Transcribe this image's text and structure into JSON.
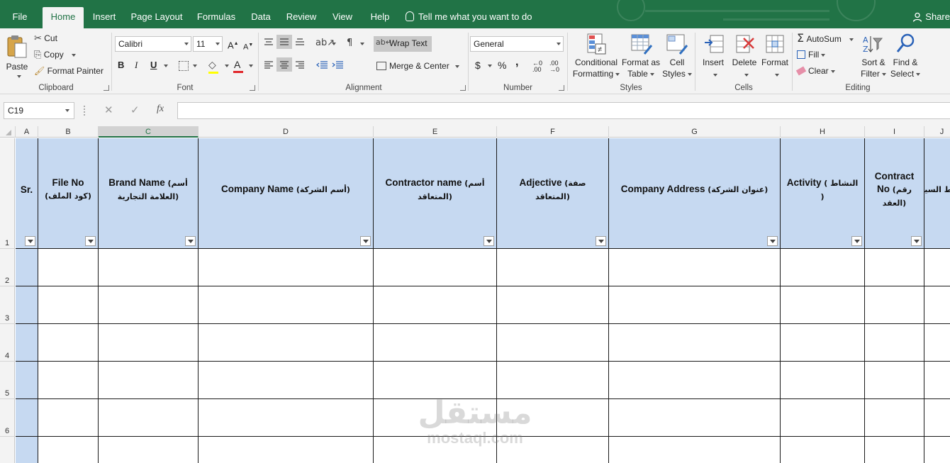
{
  "tabs": [
    {
      "key": "file",
      "label": "File"
    },
    {
      "key": "home",
      "label": "Home"
    },
    {
      "key": "insert",
      "label": "Insert"
    },
    {
      "key": "page_layout",
      "label": "Page Layout"
    },
    {
      "key": "formulas",
      "label": "Formulas"
    },
    {
      "key": "data",
      "label": "Data"
    },
    {
      "key": "review",
      "label": "Review"
    },
    {
      "key": "view",
      "label": "View"
    },
    {
      "key": "help",
      "label": "Help"
    }
  ],
  "active_tab": "Home",
  "tell_me": "Tell me what you want to do",
  "share": "Share",
  "ribbon": {
    "clipboard": {
      "paste": "Paste",
      "cut": "Cut",
      "copy": "Copy",
      "format_painter": "Format Painter",
      "label": "Clipboard"
    },
    "font": {
      "font_name": "Calibri",
      "font_size": "11",
      "bold": "B",
      "italic": "I",
      "underline": "U",
      "label": "Font"
    },
    "alignment": {
      "wrap_text": "Wrap Text",
      "merge_center": "Merge & Center",
      "label": "Alignment"
    },
    "number": {
      "format": "General",
      "currency": "$",
      "percent": "%",
      "comma": ",",
      "label": "Number"
    },
    "styles": {
      "conditional_1": "Conditional",
      "conditional_2": "Formatting",
      "format_as_1": "Format as",
      "format_as_2": "Table",
      "cell_styles_1": "Cell",
      "cell_styles_2": "Styles",
      "label": "Styles"
    },
    "cells": {
      "insert": "Insert",
      "delete": "Delete",
      "format": "Format",
      "label": "Cells"
    },
    "editing": {
      "autosum": "AutoSum",
      "fill": "Fill",
      "clear": "Clear",
      "sort_1": "Sort &",
      "sort_2": "Filter",
      "find_1": "Find &",
      "find_2": "Select",
      "label": "Editing"
    }
  },
  "formula_bar": {
    "name_box": "C19",
    "fx": "fx",
    "formula": ""
  },
  "columns": [
    "A",
    "B",
    "C",
    "D",
    "E",
    "F",
    "G",
    "H",
    "I",
    "J"
  ],
  "selected_column": "C",
  "rows": [
    "1",
    "2",
    "3",
    "4",
    "5",
    "6"
  ],
  "headers": {
    "A": {
      "en": "Sr.",
      "ar": ""
    },
    "B": {
      "en": "File No",
      "ar": "(كود الملف)"
    },
    "C": {
      "en": "Brand Name",
      "ar": "(أسم العلامة التجارية)"
    },
    "D": {
      "en": "Company Name",
      "ar": "(أسم الشركة)"
    },
    "E": {
      "en": "Contractor name",
      "ar": "(أسم المتعاقد)"
    },
    "F": {
      "en": "Adjective",
      "ar": "(صفة المتعاقد)"
    },
    "G": {
      "en": "Company Address",
      "ar": "(عنوان الشركة)"
    },
    "H": {
      "en": "Activity",
      "ar": "( النشاط )"
    },
    "I": {
      "en": "Contract No",
      "ar": "(رقم العقد)"
    },
    "J": {
      "en": "",
      "ar": "ربط السيستم"
    }
  },
  "colors": {
    "excel_green": "#217346",
    "header_fill": "#c6d9f1",
    "ribbon_bg": "#f3f3f3"
  },
  "watermark": {
    "ar": "مستقل",
    "lat": "mostaql.com"
  }
}
